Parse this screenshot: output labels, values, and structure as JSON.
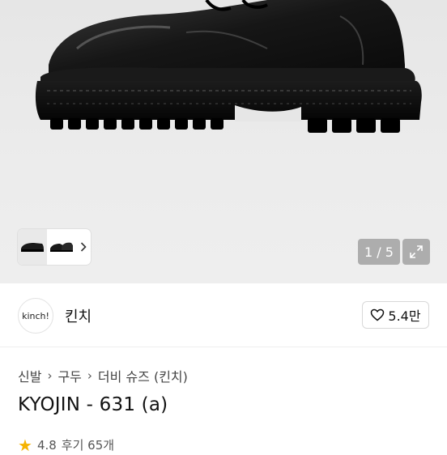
{
  "gallery": {
    "counter": "1 / 5",
    "expand_icon": "expand-arrows-icon",
    "thumb_chevron_icon": "chevron-right-icon"
  },
  "shop": {
    "logo_text": "kinch!",
    "name": "킨치",
    "like_icon": "heart-outline-icon",
    "likes": "5.4만"
  },
  "breadcrumb": [
    "신발",
    "구두",
    "더비 슈즈 (킨치)"
  ],
  "product": {
    "title": "KYOJIN - 631 (a)"
  },
  "rating": {
    "score": "4.8",
    "reviews": "후기 65개"
  },
  "colors": {
    "star": "#f5b301",
    "hero_bg": "#e8e8e8"
  }
}
